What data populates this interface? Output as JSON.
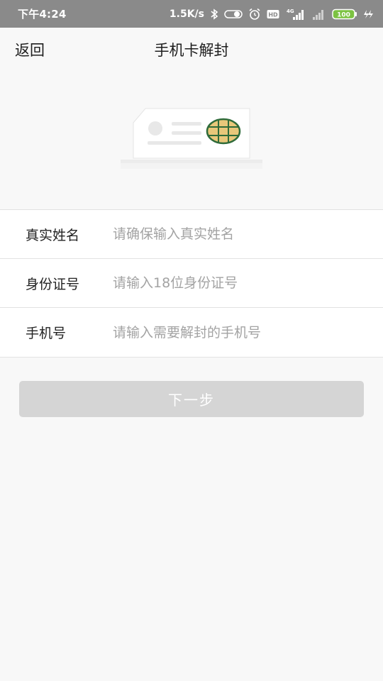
{
  "status_bar": {
    "time": "下午4:24",
    "net_speed": "1.5K/s",
    "hd_badge": "HD",
    "network_type": "4G",
    "battery": "100"
  },
  "nav": {
    "back_label": "返回",
    "title": "手机卡解封"
  },
  "form": {
    "rows": [
      {
        "label": "真实姓名",
        "placeholder": "请确保输入真实姓名",
        "value": ""
      },
      {
        "label": "身份证号",
        "placeholder": "请输入18位身份证号",
        "value": ""
      },
      {
        "label": "手机号",
        "placeholder": "请输入需要解封的手机号",
        "value": ""
      }
    ]
  },
  "next_button": {
    "label": "下一步",
    "enabled": false
  },
  "colors": {
    "status_bar_bg": "#8a8a8a",
    "page_bg": "#f8f8f8",
    "button_disabled_bg": "#d5d5d5",
    "battery_green": "#7cc242",
    "sim_chip_green": "#2f6b3a",
    "sim_chip_gold": "#e8c77a"
  },
  "icons": [
    "bluetooth-icon",
    "toggle-icon",
    "alarm-icon",
    "hd-icon",
    "signal-icon",
    "signal-weak-icon",
    "battery-icon",
    "charging-icon",
    "sim-card-icon"
  ]
}
